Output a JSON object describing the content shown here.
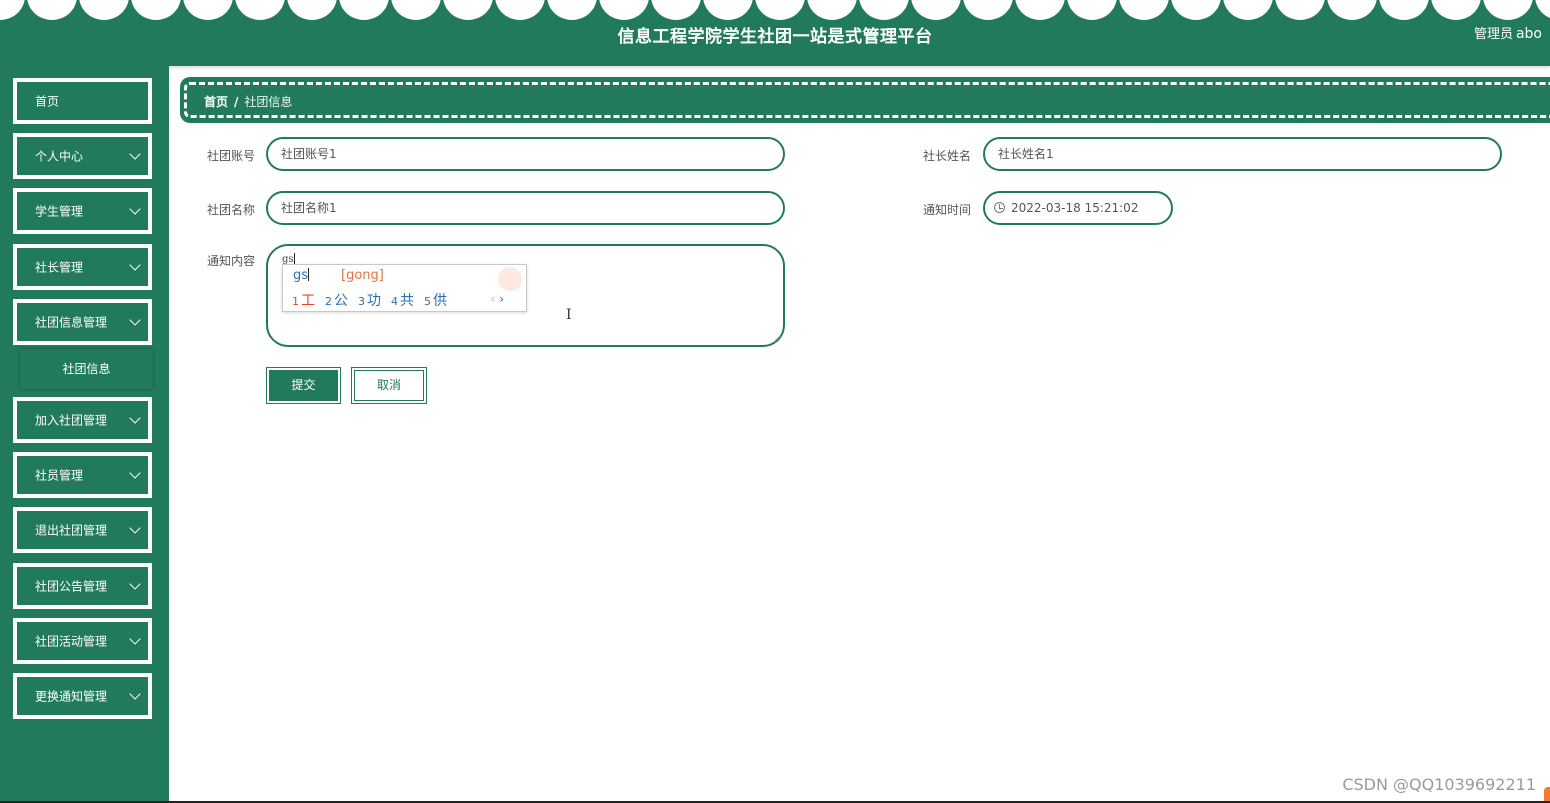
{
  "header": {
    "title": "信息工程学院学生社团一站是式管理平台",
    "user_role": "管理员",
    "user_name": "abo",
    "color": "#227a5d"
  },
  "sidebar": {
    "items": [
      {
        "label": "首页",
        "has_submenu": false
      },
      {
        "label": "个人中心",
        "has_submenu": true
      },
      {
        "label": "学生管理",
        "has_submenu": true
      },
      {
        "label": "社长管理",
        "has_submenu": true
      },
      {
        "label": "社团信息管理",
        "has_submenu": true,
        "expanded": true
      },
      {
        "label": "加入社团管理",
        "has_submenu": true
      },
      {
        "label": "社员管理",
        "has_submenu": true
      },
      {
        "label": "退出社团管理",
        "has_submenu": true
      },
      {
        "label": "社团公告管理",
        "has_submenu": true
      },
      {
        "label": "社团活动管理",
        "has_submenu": true
      },
      {
        "label": "更换通知管理",
        "has_submenu": true
      }
    ],
    "sub_item": "社团信息"
  },
  "breadcrumb": {
    "home": "首页",
    "separator": "/",
    "current": "社团信息"
  },
  "form": {
    "club_account": {
      "label": "社团账号",
      "value": "社团账号1"
    },
    "president_name": {
      "label": "社长姓名",
      "value": "社长姓名1"
    },
    "club_name": {
      "label": "社团名称",
      "value": "社团名称1"
    },
    "notify_time": {
      "label": "通知时间",
      "value": "2022-03-18 15:21:02"
    },
    "notify_content": {
      "label": "通知内容",
      "value": "gs"
    },
    "submit_label": "提交",
    "cancel_label": "取消"
  },
  "ime_popup": {
    "composition": "gs",
    "pinyin": "[gong]",
    "candidates": [
      {
        "num": "1",
        "text": "工"
      },
      {
        "num": "2",
        "text": "公"
      },
      {
        "num": "3",
        "text": "功"
      },
      {
        "num": "4",
        "text": "共"
      },
      {
        "num": "5",
        "text": "供"
      }
    ],
    "prev": "‹",
    "next": "›"
  },
  "watermark": "CSDN @QQ1039692211"
}
